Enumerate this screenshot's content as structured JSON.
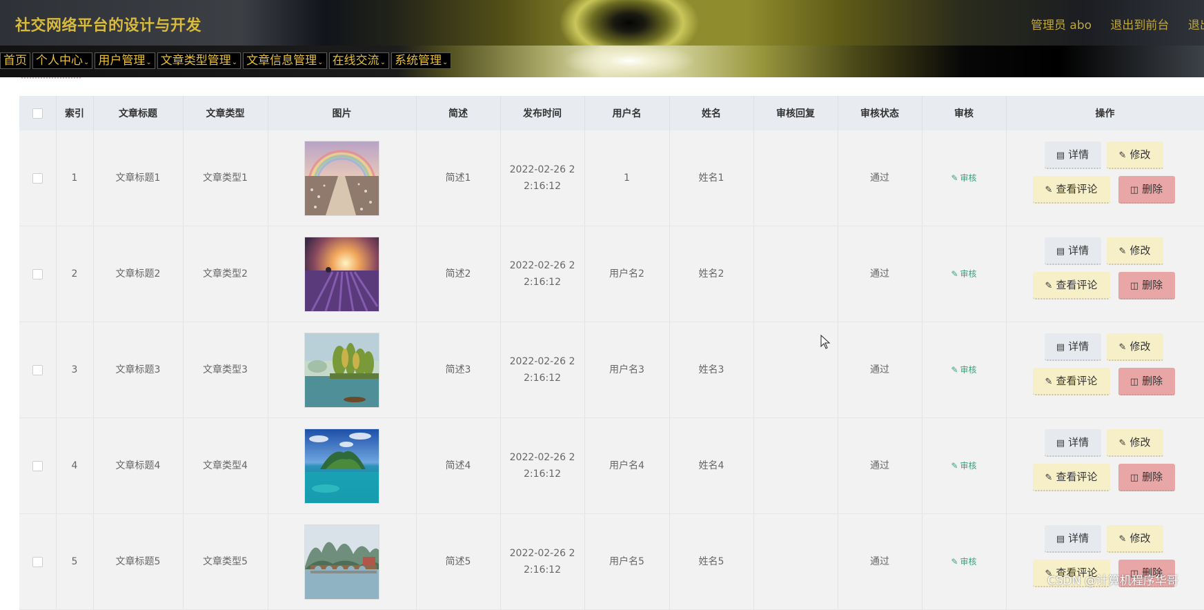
{
  "header": {
    "title": "社交网络平台的设计与开发",
    "links": [
      "管理员 abo",
      "退出到前台",
      "退出"
    ]
  },
  "nav": {
    "items": [
      "首页",
      "个人中心",
      "用户管理",
      "文章类型管理",
      "文章信息管理",
      "在线交流",
      "系统管理"
    ]
  },
  "table": {
    "columns": [
      "",
      "索引",
      "文章标题",
      "文章类型",
      "图片",
      "简述",
      "发布时间",
      "用户名",
      "姓名",
      "审核回复",
      "审核状态",
      "审核",
      "操作"
    ],
    "rows": [
      {
        "index": "1",
        "title": "文章标题1",
        "type": "文章类型1",
        "image": "rainbow-path",
        "summary": "简述1",
        "time": "2022-02-26 2\n2:16:12",
        "username": "1",
        "name": "姓名1",
        "reply": "",
        "status": "通过",
        "audit": "审核"
      },
      {
        "index": "2",
        "title": "文章标题2",
        "type": "文章类型2",
        "image": "lavender-sunset",
        "summary": "简述2",
        "time": "2022-02-26 2\n2:16:12",
        "username": "用户名2",
        "name": "姓名2",
        "reply": "",
        "status": "通过",
        "audit": "审核"
      },
      {
        "index": "3",
        "title": "文章标题3",
        "type": "文章类型3",
        "image": "lake-trees",
        "summary": "简述3",
        "time": "2022-02-26 2\n2:16:12",
        "username": "用户名3",
        "name": "姓名3",
        "reply": "",
        "status": "通过",
        "audit": "审核"
      },
      {
        "index": "4",
        "title": "文章标题4",
        "type": "文章类型4",
        "image": "tropical-island",
        "summary": "简述4",
        "time": "2022-02-26 2\n2:16:12",
        "username": "用户名4",
        "name": "姓名4",
        "reply": "",
        "status": "通过",
        "audit": "审核"
      },
      {
        "index": "5",
        "title": "文章标题5",
        "type": "文章类型5",
        "image": "karst-bridge",
        "summary": "简述5",
        "time": "2022-02-26 2\n2:16:12",
        "username": "用户名5",
        "name": "姓名5",
        "reply": "",
        "status": "通过",
        "audit": "审核"
      }
    ],
    "actions": {
      "detail": "详情",
      "edit": "修改",
      "comments": "查看评论",
      "delete": "删除"
    }
  },
  "watermark": "CSDN @计算机程序华哥",
  "colors": {
    "title": "#d8ba3c",
    "nav_text": "#e6c03c",
    "audit_link": "#3aa27a",
    "delete_btn": "#e8a6a6",
    "edit_btn": "#f6efc8",
    "detail_btn": "#e6e9ee",
    "header_bg": "#e8ebf0",
    "row_bg": "#f2f2f2"
  }
}
